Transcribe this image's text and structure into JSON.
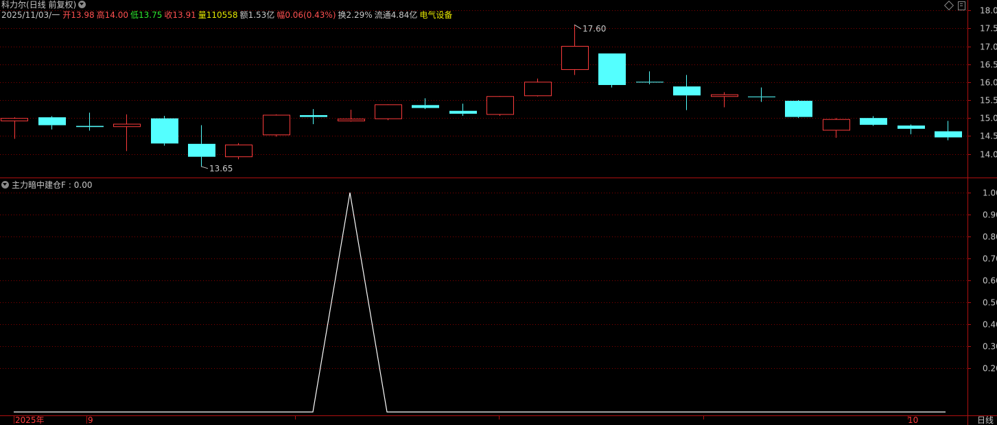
{
  "header": {
    "stock_name": "科力尔",
    "mode": "(日线 前复权)",
    "date": "2025/11/03/一",
    "open_label": "开",
    "open": "13.98",
    "high_label": "高",
    "high": "14.00",
    "low_label": "低",
    "low": "13.75",
    "close_label": "收",
    "close": "13.91",
    "volume_label": "量",
    "volume": "110558",
    "amount_label": "额",
    "amount": "1.53亿",
    "change_label": "幅",
    "change": "0.06(0.43%)",
    "turnover_label": "换",
    "turnover": "2.29%",
    "float_label": "流通",
    "float": "4.84亿",
    "sector": "电气设备"
  },
  "indicator": {
    "title": "主力暗中建仓F",
    "value": ": 0.00"
  },
  "bottom": {
    "year_label": "2025年",
    "month_sep": "9",
    "month_oct": "10",
    "period_button": "日线"
  },
  "colors": {
    "up": "#ff3c3c",
    "down": "#54ffff",
    "grid": "#8b0000",
    "frame": "#b01010",
    "axis_text": "#c8c8c8"
  },
  "chart_data": [
    {
      "type": "candlestick",
      "title": "",
      "ylim": [
        13.55,
        18.05
      ],
      "yticks": [
        "18.00",
        "17.50",
        "17.00",
        "16.50",
        "16.00",
        "15.50",
        "15.00",
        "14.50",
        "14.00"
      ],
      "annotations": [
        {
          "text": "17.60",
          "index": 15,
          "value": 17.6
        },
        {
          "text": "13.65",
          "index": 5,
          "value": 13.65
        }
      ],
      "candles": [
        {
          "o": 14.92,
          "c": 14.99,
          "h": 15.02,
          "l": 14.42
        },
        {
          "o": 15.02,
          "c": 14.8,
          "h": 15.05,
          "l": 14.68
        },
        {
          "o": 14.78,
          "c": 14.75,
          "h": 15.15,
          "l": 14.65
        },
        {
          "o": 14.76,
          "c": 14.83,
          "h": 15.1,
          "l": 14.08
        },
        {
          "o": 14.99,
          "c": 14.29,
          "h": 15.06,
          "l": 14.23
        },
        {
          "o": 14.28,
          "c": 13.92,
          "h": 14.8,
          "l": 13.65
        },
        {
          "o": 13.92,
          "c": 14.25,
          "h": 14.3,
          "l": 13.85
        },
        {
          "o": 14.53,
          "c": 15.08,
          "h": 15.1,
          "l": 14.48
        },
        {
          "o": 15.08,
          "c": 15.03,
          "h": 15.25,
          "l": 14.83
        },
        {
          "o": 14.92,
          "c": 14.97,
          "h": 15.23,
          "l": 14.9
        },
        {
          "o": 14.98,
          "c": 15.37,
          "h": 15.38,
          "l": 14.94
        },
        {
          "o": 15.36,
          "c": 15.28,
          "h": 15.55,
          "l": 15.25
        },
        {
          "o": 15.2,
          "c": 15.12,
          "h": 15.4,
          "l": 15.06
        },
        {
          "o": 15.1,
          "c": 15.6,
          "h": 15.61,
          "l": 15.06
        },
        {
          "o": 15.62,
          "c": 16.0,
          "h": 16.1,
          "l": 15.6
        },
        {
          "o": 16.35,
          "c": 17.0,
          "h": 17.6,
          "l": 16.2
        },
        {
          "o": 16.8,
          "c": 15.92,
          "h": 16.8,
          "l": 15.85
        },
        {
          "o": 16.01,
          "c": 15.99,
          "h": 16.3,
          "l": 15.94
        },
        {
          "o": 15.88,
          "c": 15.63,
          "h": 16.2,
          "l": 15.22
        },
        {
          "o": 15.6,
          "c": 15.65,
          "h": 15.72,
          "l": 15.3
        },
        {
          "o": 15.6,
          "c": 15.58,
          "h": 15.85,
          "l": 15.45
        },
        {
          "o": 15.48,
          "c": 15.03,
          "h": 15.5,
          "l": 15.0
        },
        {
          "o": 14.66,
          "c": 14.96,
          "h": 15.0,
          "l": 14.45
        },
        {
          "o": 15.0,
          "c": 14.81,
          "h": 15.05,
          "l": 14.78
        },
        {
          "o": 14.79,
          "c": 14.7,
          "h": 14.82,
          "l": 14.55
        },
        {
          "o": 14.63,
          "c": 14.46,
          "h": 14.92,
          "l": 14.38
        }
      ]
    },
    {
      "type": "line",
      "title": "主力暗中建仓F",
      "ylim": [
        0,
        1.06
      ],
      "yticks": [
        "1.00",
        "0.90",
        "0.80",
        "0.70",
        "0.60",
        "0.50",
        "0.40",
        "0.30",
        "0.20"
      ],
      "series": [
        {
          "values": [
            0,
            0,
            0,
            0,
            0,
            0,
            0,
            0,
            0,
            1,
            0,
            0,
            0,
            0,
            0,
            0,
            0,
            0,
            0,
            0,
            0,
            0,
            0,
            0,
            0,
            0
          ]
        }
      ]
    }
  ]
}
